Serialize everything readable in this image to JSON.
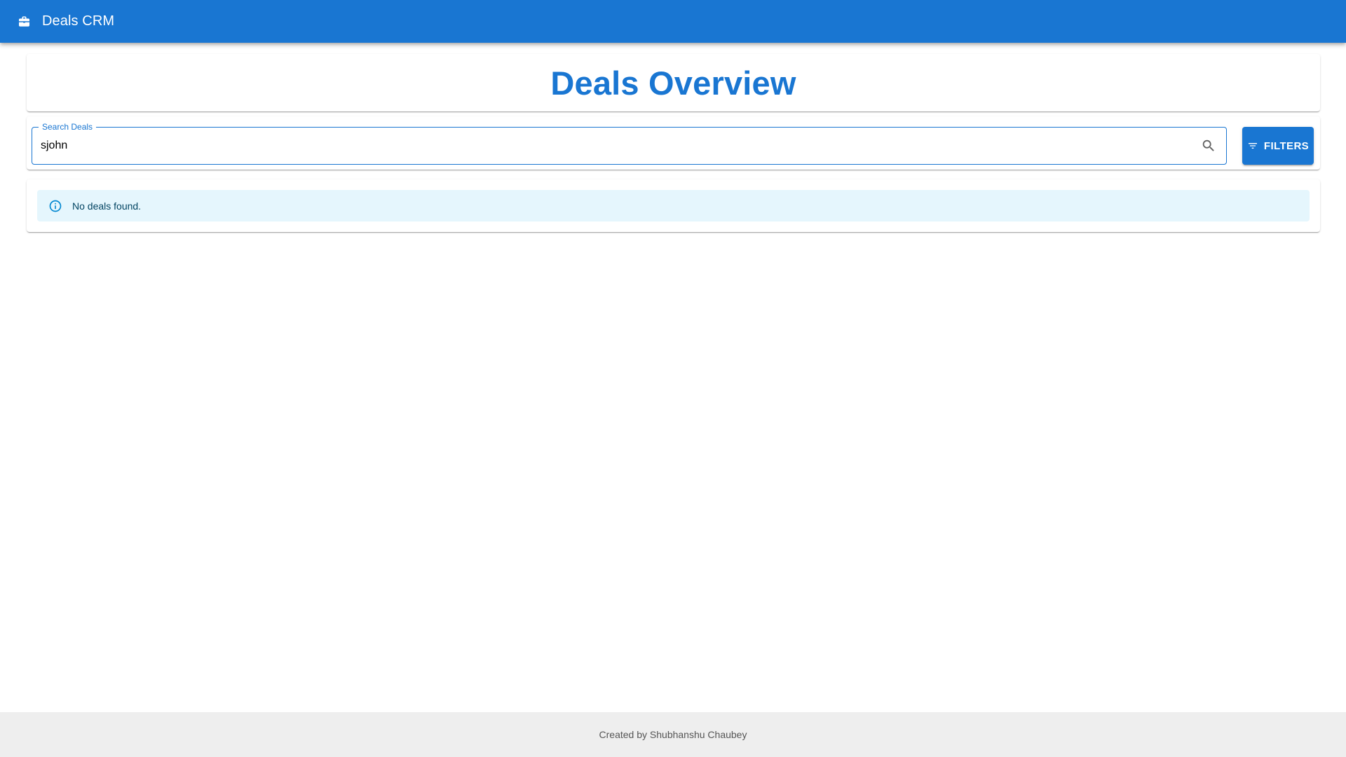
{
  "app_bar": {
    "icon": "briefcase-icon",
    "title": "Deals CRM",
    "background": "#1976d2"
  },
  "page": {
    "title": "Deals Overview",
    "title_color": "#1976d2"
  },
  "search": {
    "label": "Search Deals",
    "value": "sjohn",
    "icon": "search-icon"
  },
  "filters_button": {
    "icon": "filter-list-icon",
    "label": "FILTERS"
  },
  "results": {
    "alert_icon": "info-icon",
    "message": "No deals found.",
    "alert_background": "#e5f6fd"
  },
  "footer": {
    "text": "Created by Shubhanshu Chaubey"
  }
}
